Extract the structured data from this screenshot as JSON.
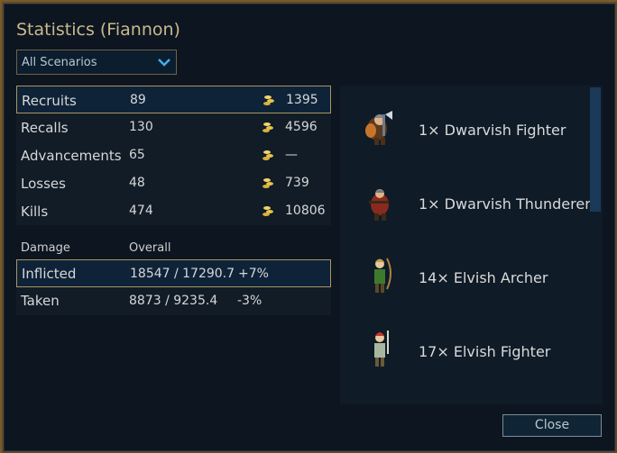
{
  "window": {
    "title": "Statistics (Fiannon)"
  },
  "scenario_select": {
    "selected": "All Scenarios"
  },
  "stats": [
    {
      "label": "Recruits",
      "count": "89",
      "gold": "1395",
      "selected": true
    },
    {
      "label": "Recalls",
      "count": "130",
      "gold": "4596",
      "selected": false
    },
    {
      "label": "Advancements",
      "count": "65",
      "gold": "—",
      "selected": false
    },
    {
      "label": "Losses",
      "count": "48",
      "gold": "739",
      "selected": false
    },
    {
      "label": "Kills",
      "count": "474",
      "gold": "10806",
      "selected": false
    }
  ],
  "damage": {
    "header_label": "Damage",
    "header_scope": "Overall",
    "rows": [
      {
        "label": "Inflicted",
        "value": "18547 / 17290.7",
        "pct": "+7%",
        "selected": true
      },
      {
        "label": "Taken",
        "value": "8873 / 9235.4",
        "pct": "-3%",
        "selected": false
      }
    ]
  },
  "units": [
    {
      "label": "1× Dwarvish Fighter",
      "icon": "dwarvish-fighter-sprite"
    },
    {
      "label": "1× Dwarvish Thunderer",
      "icon": "dwarvish-thunderer-sprite"
    },
    {
      "label": "14× Elvish Archer",
      "icon": "elvish-archer-sprite"
    },
    {
      "label": "17× Elvish Fighter",
      "icon": "elvish-fighter-sprite"
    },
    {
      "label": "",
      "icon": "partial-unit-sprite"
    }
  ],
  "buttons": {
    "close": "Close"
  },
  "colors": {
    "accent_gold": "#a89660",
    "title": "#c9b98e",
    "panel": "#111c27"
  }
}
